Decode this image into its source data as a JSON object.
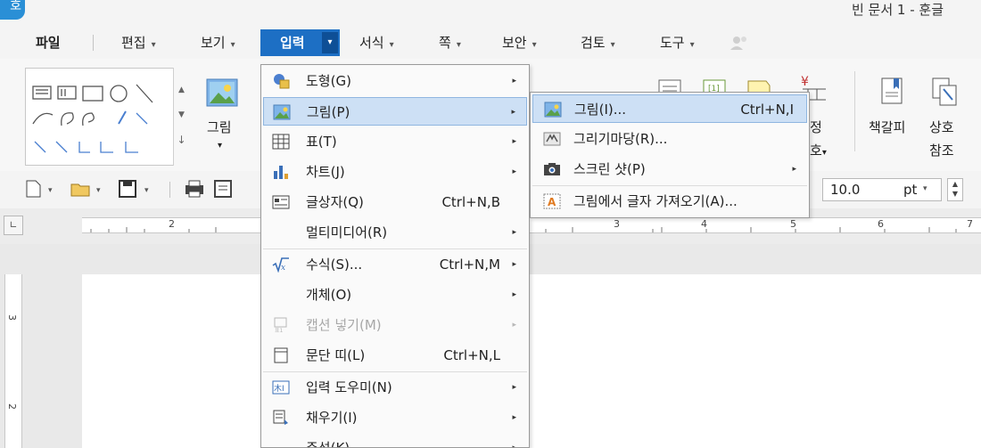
{
  "app": {
    "logo_char": "호",
    "title": "빈 문서 1 - 훈글"
  },
  "menubar": {
    "items": [
      {
        "label": "파일",
        "dropdown": ""
      },
      {
        "label": "편집",
        "dropdown": "▾"
      },
      {
        "label": "보기",
        "dropdown": "▾"
      },
      {
        "label": "입력",
        "dropdown": "▾"
      },
      {
        "label": "서식",
        "dropdown": "▾"
      },
      {
        "label": "쪽",
        "dropdown": "▾"
      },
      {
        "label": "보안",
        "dropdown": "▾"
      },
      {
        "label": "검토",
        "dropdown": "▾"
      },
      {
        "label": "도구",
        "dropdown": "▾"
      }
    ]
  },
  "ribbon": {
    "picture_label": "그림",
    "partial_label_top": "정",
    "partial_label_bottom": "호",
    "bookmark_label": "책갈피",
    "crossref_label_top": "상호",
    "crossref_label_bottom": "참조"
  },
  "toolbar": {
    "font_size_value": "10.0",
    "font_size_unit": "pt"
  },
  "ruler": {
    "h_numbers": [
      "2",
      "3",
      "4",
      "5",
      "6",
      "7"
    ],
    "v_numbers": [
      "3",
      "2"
    ]
  },
  "insert_menu": {
    "items": [
      {
        "label": "도형(G)",
        "shortcut": "",
        "arrow": "▸",
        "icon": "shape-icon"
      },
      {
        "label": "그림(P)",
        "shortcut": "",
        "arrow": "▸",
        "icon": "picture-icon"
      },
      {
        "label": "표(T)",
        "shortcut": "",
        "arrow": "▸",
        "icon": "table-icon"
      },
      {
        "label": "차트(J)",
        "shortcut": "",
        "arrow": "▸",
        "icon": "chart-icon"
      },
      {
        "label": "글상자(Q)",
        "shortcut": "Ctrl+N,B",
        "arrow": "",
        "icon": "textbox-icon"
      },
      {
        "label": "멀티미디어(R)",
        "shortcut": "",
        "arrow": "▸",
        "icon": ""
      },
      {
        "label": "수식(S)...",
        "shortcut": "Ctrl+N,M",
        "arrow": "▸",
        "icon": "formula-icon"
      },
      {
        "label": "개체(O)",
        "shortcut": "",
        "arrow": "▸",
        "icon": ""
      },
      {
        "label": "캡션 넣기(M)",
        "shortcut": "",
        "arrow": "▸",
        "icon": "caption-icon"
      },
      {
        "label": "문단 띠(L)",
        "shortcut": "Ctrl+N,L",
        "arrow": "",
        "icon": "paragraph-band-icon"
      },
      {
        "label": "입력 도우미(N)",
        "shortcut": "",
        "arrow": "▸",
        "icon": "input-helper-icon"
      },
      {
        "label": "채우기(I)",
        "shortcut": "",
        "arrow": "▸",
        "icon": "fill-icon"
      },
      {
        "label": "주석(K)",
        "shortcut": "",
        "arrow": "▸",
        "icon": ""
      }
    ]
  },
  "picture_submenu": {
    "items": [
      {
        "label": "그림(I)...",
        "shortcut": "Ctrl+N,I",
        "arrow": "",
        "icon": "picture-icon"
      },
      {
        "label": "그리기마당(R)...",
        "shortcut": "",
        "arrow": "",
        "icon": "drawing-gallery-icon"
      },
      {
        "label": "스크린 샷(P)",
        "shortcut": "",
        "arrow": "▸",
        "icon": "screenshot-icon"
      },
      {
        "label": "그림에서 글자 가져오기(A)...",
        "shortcut": "",
        "arrow": "",
        "icon": "ocr-icon"
      }
    ]
  },
  "colors": {
    "accent": "#1d6fc4",
    "highlight": "#cde0f5",
    "highlight_border": "#8fb6e0"
  }
}
